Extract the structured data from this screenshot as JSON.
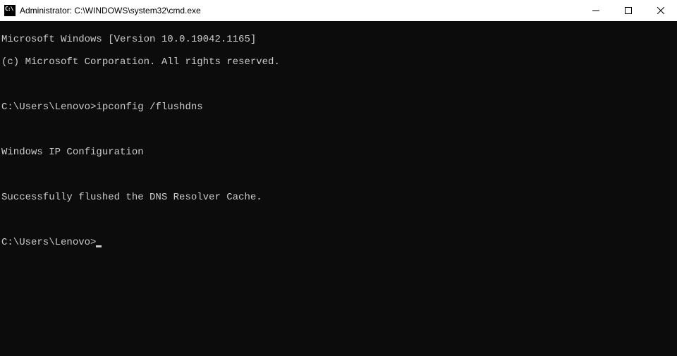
{
  "titlebar": {
    "icon_label": "C:\\",
    "title": "Administrator: C:\\WINDOWS\\system32\\cmd.exe"
  },
  "console": {
    "line1": "Microsoft Windows [Version 10.0.19042.1165]",
    "line2": "(c) Microsoft Corporation. All rights reserved.",
    "prompt1": "C:\\Users\\Lenovo>",
    "command1": "ipconfig /flushdns",
    "heading": "Windows IP Configuration",
    "result": "Successfully flushed the DNS Resolver Cache.",
    "prompt2": "C:\\Users\\Lenovo>"
  }
}
